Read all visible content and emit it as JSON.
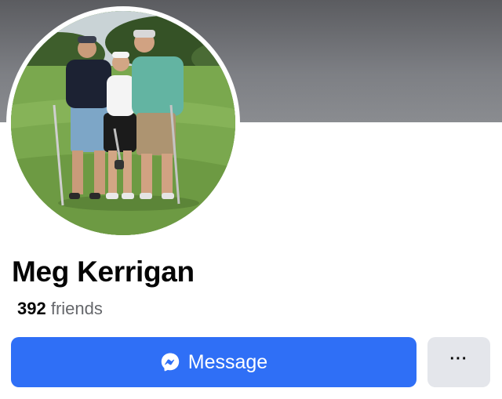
{
  "profile": {
    "name": "Meg Kerrigan",
    "friends_count": "392",
    "friends_label": "friends"
  },
  "actions": {
    "message_label": "Message",
    "message_icon": "messenger-icon",
    "more_label": "···",
    "more_icon": "more-options-icon"
  },
  "colors": {
    "primary_button": "#2f6ff6",
    "secondary_button": "#e4e6eb",
    "cover": "#6b6c70"
  }
}
